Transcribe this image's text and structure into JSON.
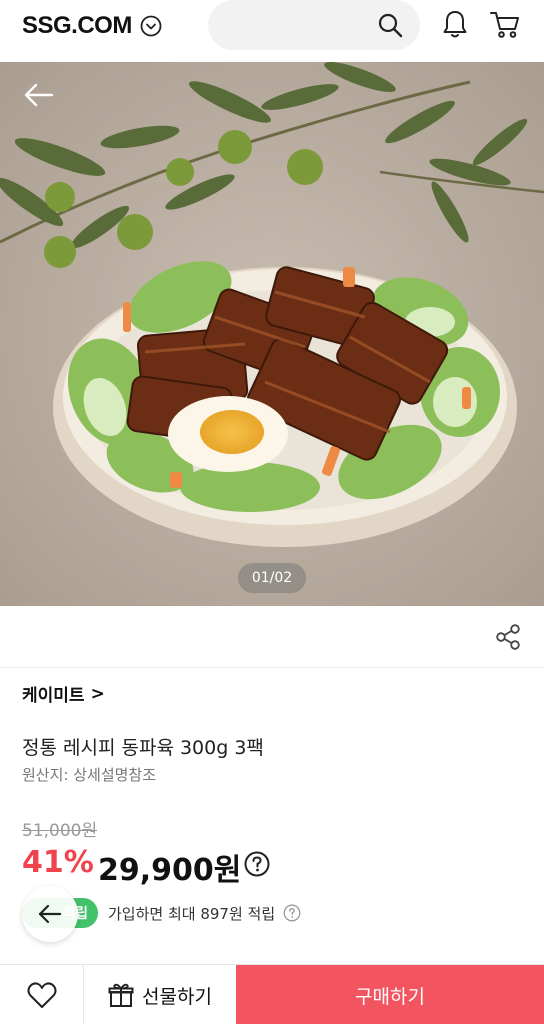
{
  "header": {
    "logo_text": "SSG.COM",
    "icons": [
      "chevron-down-icon",
      "search-icon",
      "bell-icon",
      "cart-icon"
    ]
  },
  "gallery": {
    "pager_text": "01/02"
  },
  "product": {
    "brand": "케이미트",
    "brand_chevron": ">",
    "title": "정통 레시피 동파육 300g 3팩",
    "origin": "원산지: 상세설명참조",
    "original_price": "51,000원",
    "discount": "41%",
    "price": "29,900원",
    "points_badge": "적립",
    "points_text": "가입하면 최대 897원 적립"
  },
  "bottom_bar": {
    "gift_label": "선물하기",
    "buy_label": "구매하기"
  },
  "colors": {
    "accent_red": "#f0434e",
    "buy_button": "#f25560",
    "points_green": "#43c26b"
  }
}
